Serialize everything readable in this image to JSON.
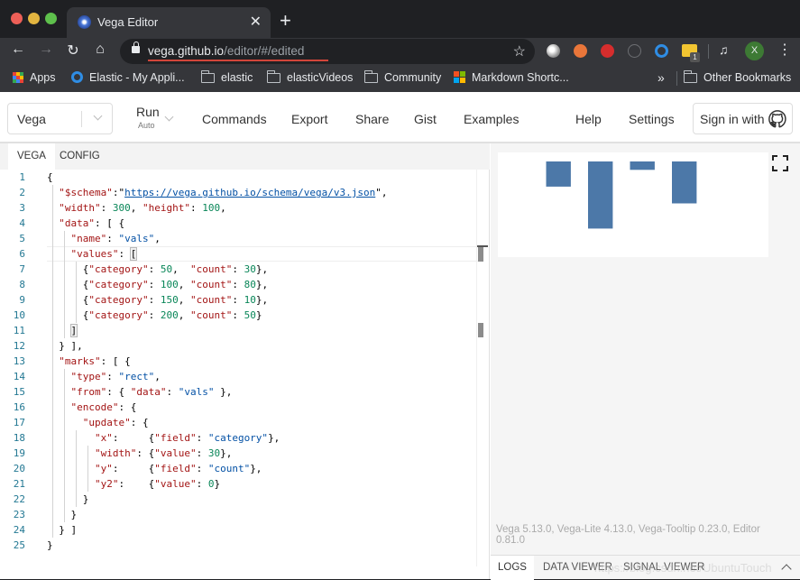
{
  "browser": {
    "tab_title": "Vega Editor",
    "url_host": "vega.github.io",
    "url_path": "/editor/#/edited",
    "profile_initial": "X",
    "extension_badge": "1",
    "bookmarks": [
      {
        "label": "Apps",
        "icon": "apps-grid-icon"
      },
      {
        "label": "Elastic - My Appli...",
        "icon": "ring-icon"
      },
      {
        "label": "elastic",
        "icon": "folder-icon"
      },
      {
        "label": "elasticVideos",
        "icon": "folder-icon"
      },
      {
        "label": "Community",
        "icon": "folder-icon"
      },
      {
        "label": "Markdown Shortc...",
        "icon": "microsoft-icon"
      }
    ],
    "more_bookmarks": "»",
    "other_bookmarks": "Other Bookmarks"
  },
  "header": {
    "mode_value": "Vega",
    "run_label": "Run",
    "run_sub": "Auto",
    "nav": [
      "Commands",
      "Export",
      "Share",
      "Gist",
      "Examples",
      "Help",
      "Settings"
    ],
    "signin_label": "Sign in with"
  },
  "editor": {
    "tabs": [
      "VEGA",
      "CONFIG"
    ],
    "active_tab": "VEGA",
    "lines": [
      {
        "n": "1"
      },
      {
        "n": "2"
      },
      {
        "n": "3"
      },
      {
        "n": "4"
      },
      {
        "n": "5"
      },
      {
        "n": "6"
      },
      {
        "n": "7"
      },
      {
        "n": "8"
      },
      {
        "n": "9"
      },
      {
        "n": "10"
      },
      {
        "n": "11"
      },
      {
        "n": "12"
      },
      {
        "n": "13"
      },
      {
        "n": "14"
      },
      {
        "n": "15"
      },
      {
        "n": "16"
      },
      {
        "n": "17"
      },
      {
        "n": "18"
      },
      {
        "n": "19"
      },
      {
        "n": "20"
      },
      {
        "n": "21"
      },
      {
        "n": "22"
      },
      {
        "n": "23"
      },
      {
        "n": "24"
      },
      {
        "n": "25"
      }
    ],
    "code": {
      "schema_key": "\"$schema\"",
      "schema_url": "https://vega.github.io/schema/vega/v3.json",
      "width_key": "\"width\"",
      "width_val": "300",
      "height_key": "\"height\"",
      "height_val": "100",
      "data_key": "\"data\"",
      "name_key": "\"name\"",
      "name_val": "\"vals\"",
      "values_key": "\"values\"",
      "category_key": "\"category\"",
      "count_key": "\"count\"",
      "rows": [
        {
          "category": "50",
          "count": "30"
        },
        {
          "category": "100",
          "count": "80"
        },
        {
          "category": "150",
          "count": "10"
        },
        {
          "category": "200",
          "count": "50"
        }
      ],
      "marks_key": "\"marks\"",
      "type_key": "\"type\"",
      "type_val": "\"rect\"",
      "from_key": "\"from\"",
      "data_key2": "\"data\"",
      "from_val": "\"vals\"",
      "encode_key": "\"encode\"",
      "update_key": "\"update\"",
      "x_key": "\"x\"",
      "field_key": "\"field\"",
      "x_val": "\"category\"",
      "wkey": "\"width\"",
      "value_key": "\"value\"",
      "w_val": "30",
      "y_key": "\"y\"",
      "y_val": "\"count\"",
      "y2_key": "\"y2\"",
      "y2_val": "0"
    }
  },
  "preview": {
    "versions": "Vega 5.13.0, Vega-Lite 4.13.0, Vega-Tooltip 0.23.0, Editor 0.81.0",
    "bottom_tabs": [
      "LOGS",
      "DATA VIEWER",
      "SIGNAL VIEWER"
    ],
    "active_bottom_tab": "LOGS",
    "watermark": "https://blog.csdn.net/UbuntuTouch"
  },
  "chart_data": {
    "type": "bar",
    "title": "",
    "xlabel": "",
    "ylabel": "",
    "x": [
      50,
      100,
      150,
      200
    ],
    "values": [
      30,
      80,
      10,
      50
    ],
    "bar_width_units": 30,
    "xlim": [
      0,
      300
    ],
    "ylim": [
      0,
      100
    ],
    "y_direction": "downward (y field mapped to pixels without scale, y2 = 0)",
    "color": "#4c78a8",
    "grid": false,
    "legend": "none"
  }
}
